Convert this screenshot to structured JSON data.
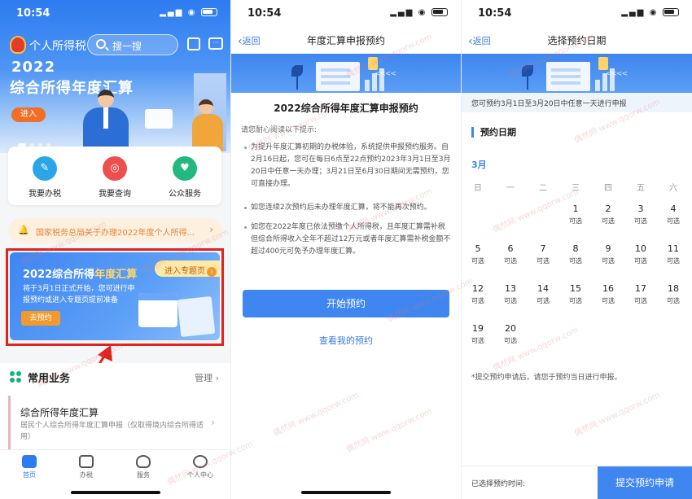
{
  "status": {
    "s1_time": "10:54",
    "s2_time": "10:54",
    "s3_time": "10:54"
  },
  "screen1": {
    "app_title": "个人所得税",
    "search_placeholder": "搜一搜",
    "hero_year": "2022",
    "hero_title": "综合所得年度汇算",
    "hero_enter": "进入",
    "quick": [
      {
        "label": "我要办税",
        "color": "#2aa6e8"
      },
      {
        "label": "我要查询",
        "color": "#ee4e4e"
      },
      {
        "label": "公众服务",
        "color": "#22b87e"
      }
    ],
    "notice": "国家税务总局关于办理2022年度个人所得...",
    "banner": {
      "title_pre": "2022综合所得",
      "title_hl": "年度汇算",
      "topic": "进入专题页",
      "desc": "将于3月1日正式开始，您可进行申报预约或进入专题页提前准备",
      "button": "去预约"
    },
    "common": {
      "title": "常用业务",
      "manage": "管理",
      "card_title": "综合所得年度汇算",
      "card_desc": "居民个人综合所得年度汇算申报（仅取得境内综合所得适用）"
    },
    "tabs": [
      "首页",
      "办税",
      "服务",
      "个人中心"
    ]
  },
  "screen2": {
    "back": "返回",
    "nav_title": "年度汇算申报预约",
    "heading": "2022综合所得年度汇算申报预约",
    "intro": "请您耐心阅读以下提示:",
    "paras": [
      "为提升年度汇算初期的办税体验，系统提供申报预约服务。自2月16日起，您可在每日6点至22点预约2023年3月1日至3月20日中任意一天办理；3月21日至6月30日期间无需预约，您可直接办理。",
      "如您连续2次预约后未办理年度汇算，将不能再次预约。",
      "如您在2022年度已依法预缴个人所得税，且年度汇算需补税但综合所得收入全年不超过12万元或者年度汇算需补税金额不超过400元可免予办理年度汇算。"
    ],
    "start": "开始预约",
    "view": "查看我的预约"
  },
  "screen3": {
    "back": "返回",
    "nav_title": "选择预约日期",
    "info": "您可预约3月1日至3月20日中任意一天进行申报",
    "label": "预约日期",
    "month": "3月",
    "weekdays": [
      "日",
      "一",
      "二",
      "三",
      "四",
      "五",
      "六"
    ],
    "available": "可选",
    "days": [
      "1",
      "2",
      "3",
      "4",
      "5",
      "6",
      "7",
      "8",
      "9",
      "10",
      "11",
      "12",
      "13",
      "14",
      "15",
      "16",
      "17",
      "18",
      "19",
      "20"
    ],
    "first_weekday_index": 3,
    "note": "*提交预约申请后，请您于预约当日进行申报。",
    "selected_label": "已选择预约时间:",
    "submit": "提交预约申请"
  },
  "watermark": "偶然网 www.qqorw.com",
  "colors": {
    "primary": "#3f86f1",
    "highlight_red": "#e0231c",
    "orange": "#f39a2f"
  }
}
